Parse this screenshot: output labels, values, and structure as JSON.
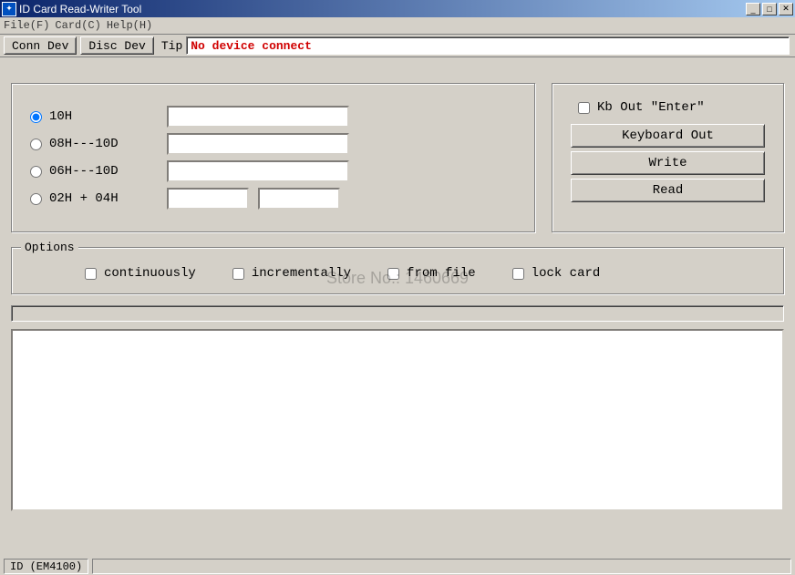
{
  "title": "ID Card Read-Writer Tool",
  "menu": {
    "file": "File(F)",
    "card": "Card(C)",
    "help": "Help(H)"
  },
  "toolbar": {
    "conn": "Conn Dev",
    "disc": "Disc Dev",
    "tip_label": "Tip",
    "tip_value": "No device connect"
  },
  "format": {
    "opt10h": "10H",
    "opt08h10d": "08H---10D",
    "opt06h10d": "06H---10D",
    "opt02h04h": "02H + 04H",
    "selected": "10H",
    "val10h": "",
    "val08h10d": "",
    "val06h10d": "",
    "val02h": "",
    "val04h": ""
  },
  "actions": {
    "kb_out_enter": "Kb Out \"Enter\"",
    "kb_out_enter_checked": false,
    "keyboard_out": "Keyboard Out",
    "write": "Write",
    "read": "Read"
  },
  "options": {
    "legend": "Options",
    "continuously": "continuously",
    "incrementally": "incrementally",
    "from_file": "from file",
    "lock_card": "lock card",
    "continuously_checked": false,
    "incrementally_checked": false,
    "from_file_checked": false,
    "lock_card_checked": false
  },
  "log": "",
  "status": {
    "tab": "ID (EM4100)"
  },
  "watermark": "Store No.: 1460669"
}
